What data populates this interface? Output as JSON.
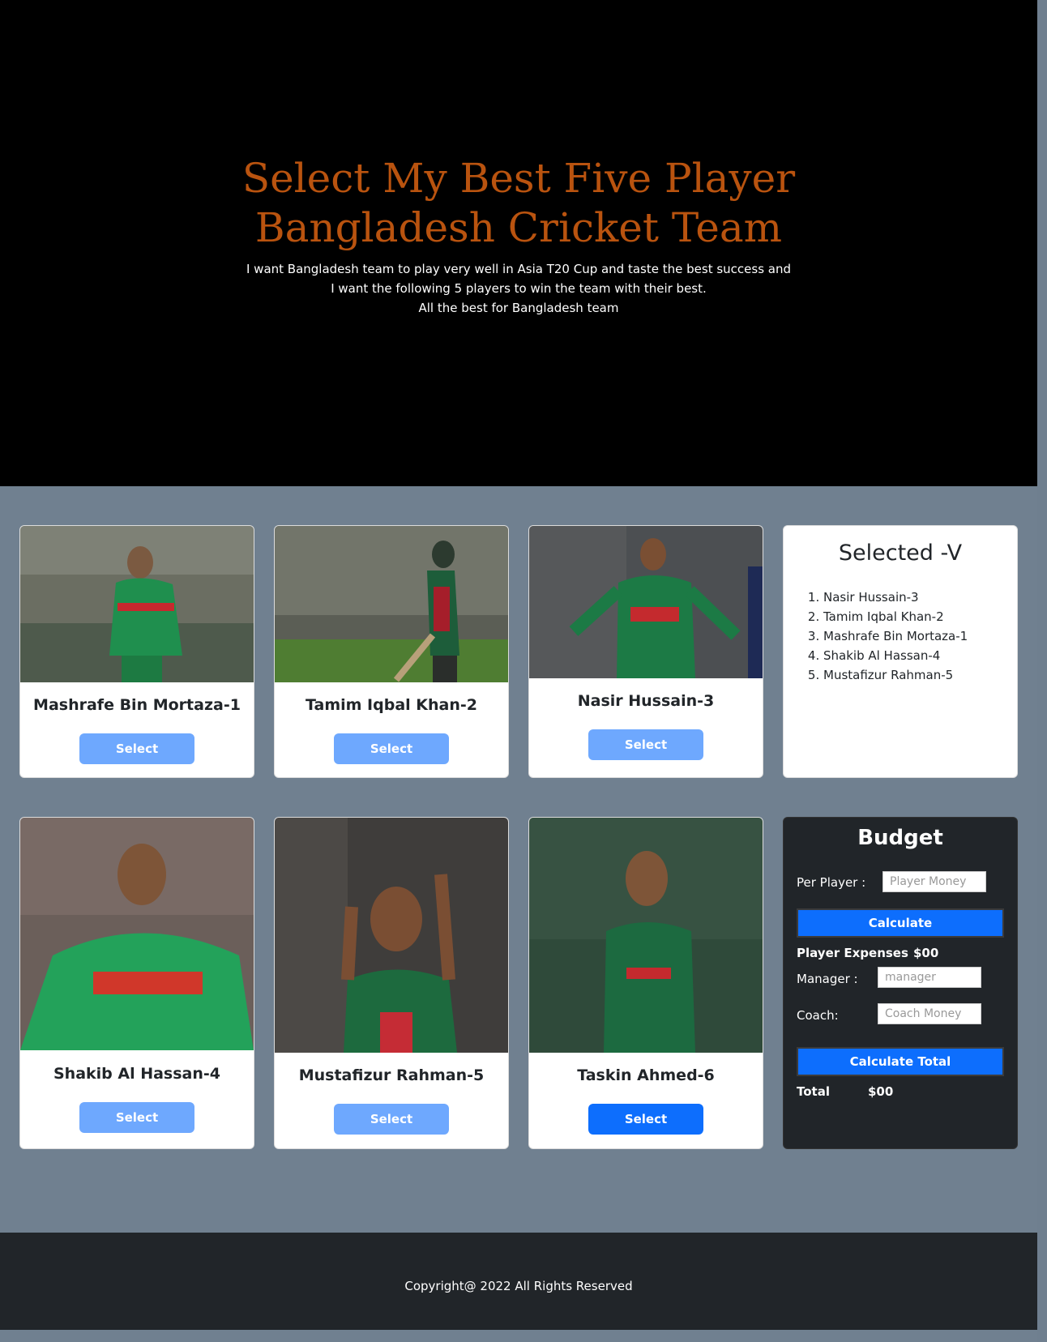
{
  "hero": {
    "title": "Select My Best Five Player Bangladesh Cricket Team",
    "subtitle_lines": [
      "I want Bangladesh team to play very well in Asia T20 Cup and taste the best success and",
      "I want the following 5 players to win the team with their best.",
      "All the best for Bangladesh team"
    ]
  },
  "players": [
    {
      "name": "Mashrafe Bin Mortaza-1",
      "button": "Select",
      "selected": true
    },
    {
      "name": "Tamim Iqbal Khan-2",
      "button": "Select",
      "selected": true
    },
    {
      "name": "Nasir Hussain-3",
      "button": "Select",
      "selected": true
    },
    {
      "name": "Shakib Al Hassan-4",
      "button": "Select",
      "selected": true
    },
    {
      "name": "Mustafizur Rahman-5",
      "button": "Select",
      "selected": true
    },
    {
      "name": "Taskin Ahmed-6",
      "button": "Select",
      "selected": false
    }
  ],
  "selected": {
    "title": "Selected -V",
    "items": [
      "Nasir Hussain-3",
      "Tamim Iqbal Khan-2",
      "Mashrafe Bin Mortaza-1",
      "Shakib Al Hassan-4",
      "Mustafizur Rahman-5"
    ]
  },
  "budget": {
    "title": "Budget",
    "per_player_label": "Per Player :",
    "per_player_placeholder": "Player Money",
    "calculate_label": "Calculate",
    "player_expenses_label": "Player Expenses",
    "player_expenses_value": "$00",
    "manager_label": "Manager :",
    "manager_placeholder": "manager",
    "coach_label": "Coach:",
    "coach_placeholder": "Coach Money",
    "calculate_total_label": "Calculate Total",
    "total_label": "Total",
    "total_value": "$00"
  },
  "footer": {
    "copyright": "Copyright@ 2022 All Rights Reserved"
  },
  "colors": {
    "page_bg": "#708090",
    "title": "#b9530f",
    "button_active": "#0d6efd",
    "button_disabled": "#6ea8fe"
  }
}
